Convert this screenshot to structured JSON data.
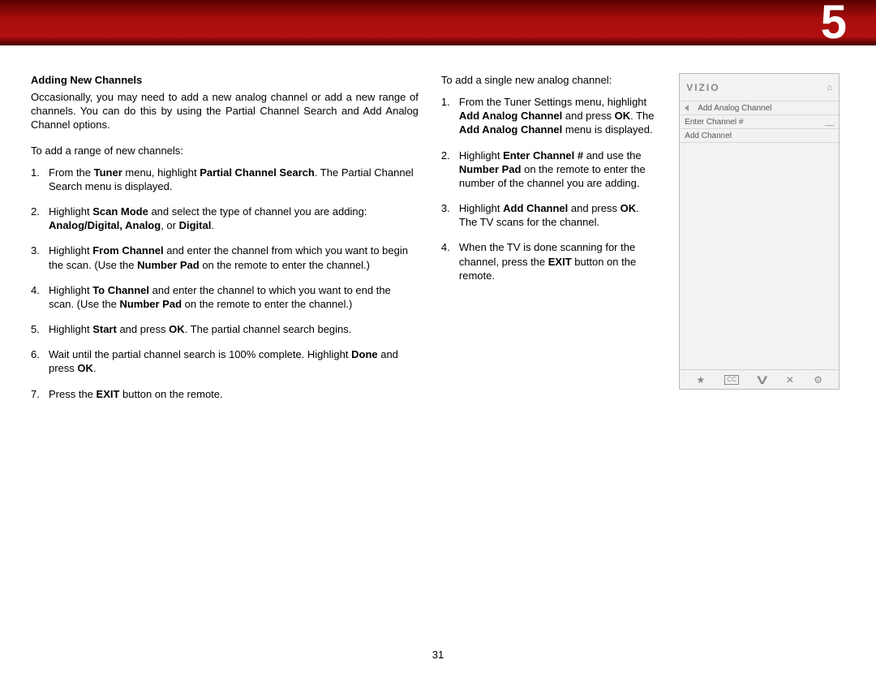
{
  "chapter": "5",
  "page_number": "31",
  "left": {
    "heading": "Adding New Channels",
    "intro": "Occasionally, you may need to add a new analog channel or add a new range of channels. You can do this by using the Partial Channel Search and Add Analog Channel options.",
    "lead": "To add a range of new channels:",
    "steps": [
      {
        "pre": "From the ",
        "b1": "Tuner",
        "mid1": " menu, highlight ",
        "b2": "Partial Channel Search",
        "post": ". The Partial Channel Search menu is displayed."
      },
      {
        "pre": "Highlight ",
        "b1": "Scan Mode",
        "mid1": " and select the type of channel you are adding: ",
        "b2": "Analog/Digital, Analog",
        "mid2": ", or ",
        "b3": "Digital",
        "post": "."
      },
      {
        "pre": "Highlight ",
        "b1": "From Channel",
        "mid1": " and enter the channel from which you want to begin the scan. (Use the ",
        "b2": "Number Pad",
        "post": " on the remote to enter the channel.)"
      },
      {
        "pre": "Highlight ",
        "b1": "To Channel",
        "mid1": " and enter the channel to which you want to end the scan. (Use the ",
        "b2": "Number Pad",
        "post": " on the remote to enter the channel.)"
      },
      {
        "pre": "Highlight ",
        "b1": "Start",
        "mid1": " and press ",
        "b2": "OK",
        "post": ". The partial channel search begins."
      },
      {
        "pre": "Wait until the partial channel search is 100% complete. Highlight ",
        "b1": "Done",
        "mid1": " and press ",
        "b2": "OK",
        "post": "."
      },
      {
        "pre": "Press the ",
        "b1": "EXIT",
        "post": " button on the remote."
      }
    ]
  },
  "mid": {
    "lead": "To add a single new analog channel:",
    "steps": [
      {
        "pre": "From the Tuner Settings menu, highlight ",
        "b1": "Add Analog Channel",
        "mid1": " and press ",
        "b2": "OK",
        "mid2": ". The ",
        "b3": "Add Analog Channel",
        "post": " menu is displayed."
      },
      {
        "pre": "Highlight ",
        "b1": "Enter Channel #",
        "mid1": " and use the ",
        "b2": "Number Pad",
        "post": " on the remote to enter the number of the channel you are adding."
      },
      {
        "pre": "Highlight ",
        "b1": "Add Channel",
        "mid1": " and press ",
        "b2": "OK",
        "post": ". The TV scans for the channel."
      },
      {
        "pre": "When the TV is done scanning for the channel, press the ",
        "b1": "EXIT",
        "post": " button on the remote."
      }
    ]
  },
  "tv": {
    "brand": "VIZIO",
    "title": "Add Analog Channel",
    "row_enter": "Enter Channel #",
    "row_enter_val": "__",
    "row_add": "Add Channel"
  }
}
